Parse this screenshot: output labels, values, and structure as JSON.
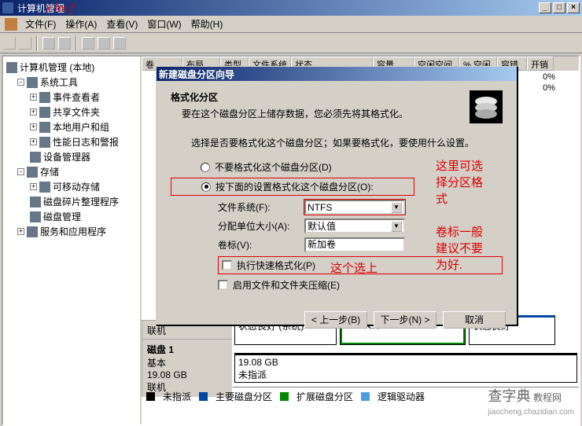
{
  "window": {
    "title": "计算机管理"
  },
  "titlebar_buttons": {
    "min": "_",
    "max": "□",
    "close": "×"
  },
  "menubar": {
    "file": "文件(F)",
    "action": "操作(A)",
    "view": "查看(V)",
    "window": "窗口(W)",
    "help": "帮助(H)"
  },
  "tree": {
    "root": "计算机管理 (本地)",
    "system_tools": "系统工具",
    "event_viewer": "事件查看者",
    "shared_folders": "共享文件夹",
    "local_users": "本地用户和组",
    "perf_logs": "性能日志和警报",
    "device_mgr": "设备管理器",
    "storage": "存储",
    "removable": "可移动存储",
    "defrag": "磁盘碎片整理程序",
    "disk_mgmt": "磁盘管理",
    "services": "服务和应用程序"
  },
  "list_headers": [
    "卷",
    "布局",
    "类型",
    "文件系统",
    "状态",
    "容量",
    "空闲空间",
    "% 空闲",
    "容错",
    "开销"
  ],
  "pct_col": [
    "0%",
    "0%"
  ],
  "dialog": {
    "title": "新建磁盘分区向导",
    "heading": "格式化分区",
    "subheading": "要在这个磁盘分区上储存数据，您必须先将其格式化。",
    "desc": "选择是否要格式化这个磁盘分区；如果要格式化，要使用什么设置。",
    "radio_no_format": "不要格式化这个磁盘分区(D)",
    "radio_do_format": "按下面的设置格式化这个磁盘分区(O):",
    "label_fs": "文件系统(F):",
    "value_fs": "NTFS",
    "label_alloc": "分配单位大小(A):",
    "value_alloc": "默认值",
    "label_vol": "卷标(V):",
    "value_vol": "新加卷",
    "check_quick": "执行快速格式化(P)",
    "check_compress": "启用文件和文件夹压缩(E)",
    "btn_back": "< 上一步(B)",
    "btn_next": "下一步(N) >",
    "btn_cancel": "取消"
  },
  "annotations": {
    "a1": "这里可选\n择分区格\n式",
    "a2": "卷标一般\n建议不要\n为好.",
    "a3": "这个选上"
  },
  "bottom": {
    "online": "联机",
    "status1": "状态良好 (系统)",
    "status2": "状态良好",
    "status3": "状态良好",
    "disk1": "磁盘 1",
    "basic": "基本",
    "size": "19.08 GB",
    "unalloc_size": "19.08 GB",
    "unalloc": "未指派"
  },
  "legend": {
    "unalloc": "未指派",
    "primary": "主要磁盘分区",
    "ext": "扩展磁盘分区",
    "logical": "逻辑驱动器"
  },
  "watermark": {
    "site": "查字典",
    "sub": "教程网",
    "url": "jiaocheng.chazidian.com"
  },
  "red_overlay": "x  lm f"
}
